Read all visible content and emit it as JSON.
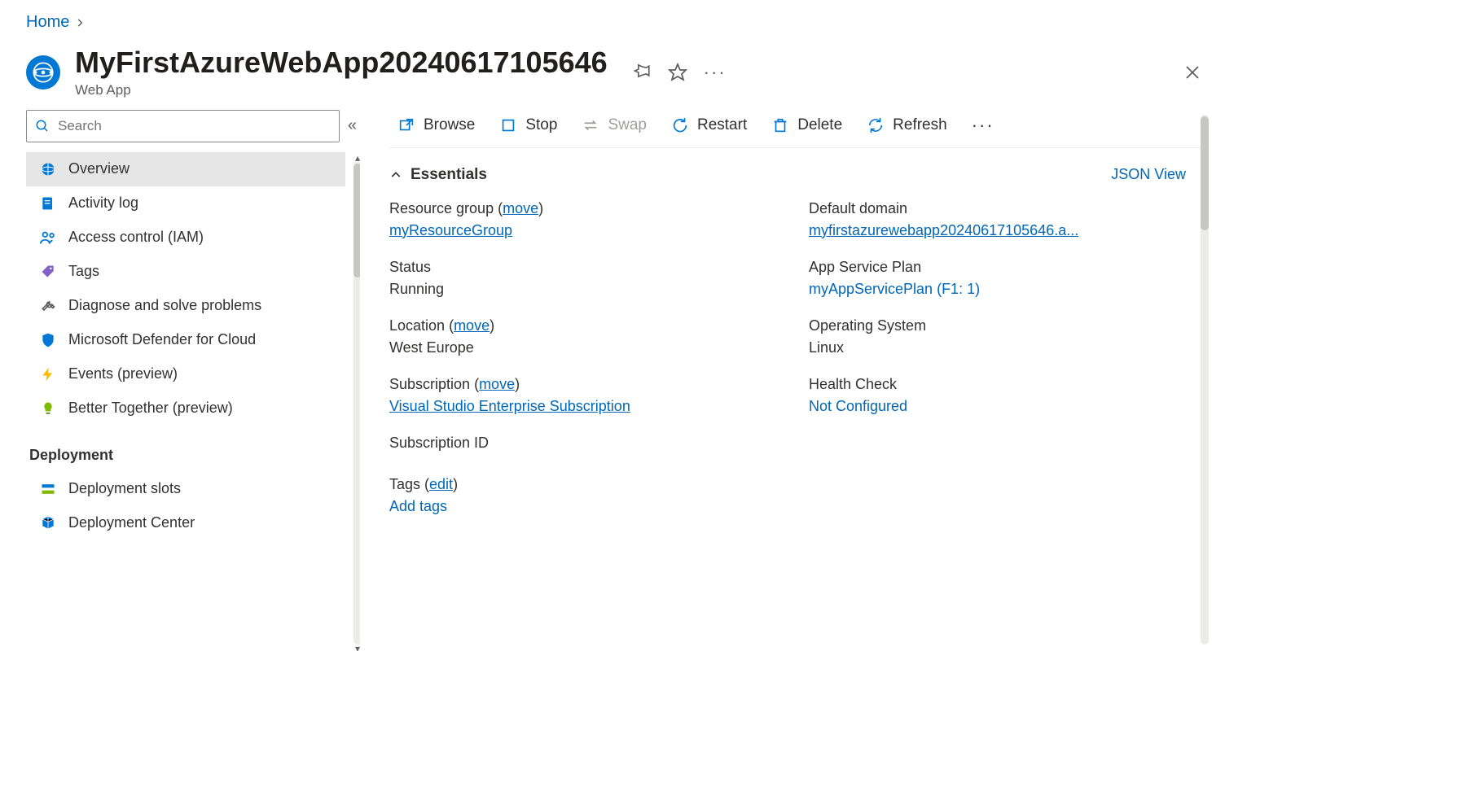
{
  "breadcrumb": {
    "home": "Home"
  },
  "header": {
    "title": "MyFirstAzureWebApp20240617105646",
    "subtitle": "Web App"
  },
  "sidebar": {
    "search_placeholder": "Search",
    "items": [
      {
        "label": "Overview"
      },
      {
        "label": "Activity log"
      },
      {
        "label": "Access control (IAM)"
      },
      {
        "label": "Tags"
      },
      {
        "label": "Diagnose and solve problems"
      },
      {
        "label": "Microsoft Defender for Cloud"
      },
      {
        "label": "Events (preview)"
      },
      {
        "label": "Better Together (preview)"
      }
    ],
    "section_deployment": "Deployment",
    "deploy_items": [
      {
        "label": "Deployment slots"
      },
      {
        "label": "Deployment Center"
      }
    ]
  },
  "toolbar": {
    "browse": "Browse",
    "stop": "Stop",
    "swap": "Swap",
    "restart": "Restart",
    "delete": "Delete",
    "refresh": "Refresh"
  },
  "essentials": {
    "title": "Essentials",
    "json_view": "JSON View",
    "move": "move",
    "edit": "edit",
    "left": {
      "resource_group_label": "Resource group",
      "resource_group_value": "myResourceGroup",
      "status_label": "Status",
      "status_value": "Running",
      "location_label": "Location",
      "location_value": "West Europe",
      "subscription_label": "Subscription",
      "subscription_value": "Visual Studio Enterprise Subscription",
      "subscription_id_label": "Subscription ID"
    },
    "right": {
      "domain_label": "Default domain",
      "domain_value": "myfirstazurewebapp20240617105646.a...",
      "plan_label": "App Service Plan",
      "plan_value": "myAppServicePlan (F1: 1)",
      "os_label": "Operating System",
      "os_value": "Linux",
      "health_label": "Health Check",
      "health_value": "Not Configured"
    },
    "tags_label": "Tags",
    "add_tags": "Add tags"
  }
}
